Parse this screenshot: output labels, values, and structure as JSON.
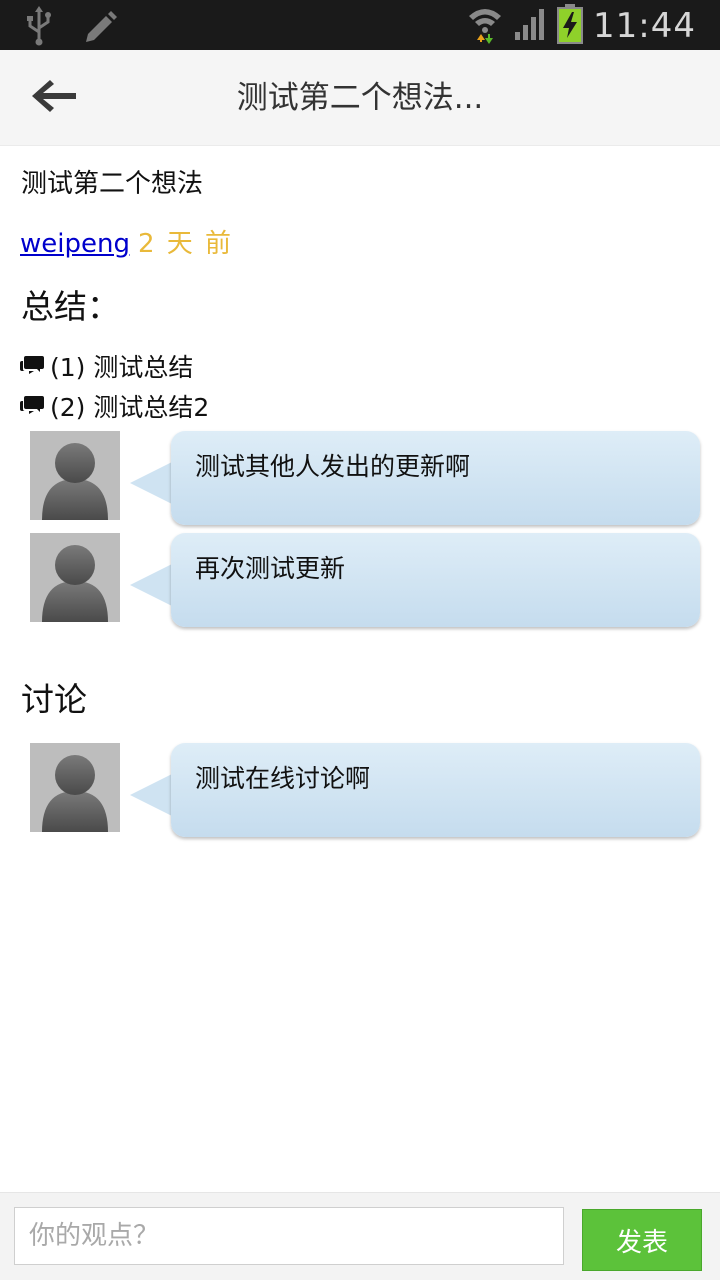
{
  "status_bar": {
    "time": "11:44",
    "icons": [
      "usb-icon",
      "edit-icon",
      "wifi-icon",
      "signal-icon",
      "battery-charging-icon"
    ]
  },
  "app_bar": {
    "title": "测试第二个想法...",
    "back_icon": "arrow-left-icon"
  },
  "idea": {
    "title": "测试第二个想法",
    "author": "weipeng",
    "time_ago": "2 天 前"
  },
  "summary": {
    "heading": "总结：",
    "items": [
      {
        "label": "(1) 测试总结",
        "icon": "comments-icon"
      },
      {
        "label": "(2) 测试总结2",
        "icon": "comments-icon"
      }
    ],
    "messages": [
      {
        "text": "测试其他人发出的更新啊"
      },
      {
        "text": "再次测试更新"
      }
    ]
  },
  "discussion": {
    "heading": "讨论",
    "messages": [
      {
        "text": "测试在线讨论啊"
      }
    ]
  },
  "composer": {
    "placeholder": "你的观点？",
    "value": "",
    "submit_label": "发表"
  },
  "colors": {
    "status_bar_bg": "#1a1a1a",
    "app_bar_bg": "#f5f5f5",
    "link": "#0000cc",
    "time_ago": "#e9b93a",
    "bubble": "#cfe3f2",
    "post_button": "#5cc23a"
  }
}
